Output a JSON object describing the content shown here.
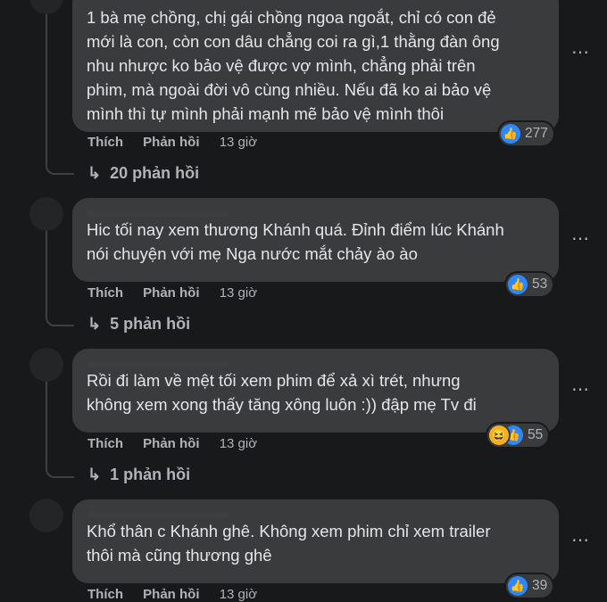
{
  "comments": [
    {
      "text": "1 bà mẹ chồng, chị gái chồng ngoa ngoắt, chỉ có con đẻ\nmới là con, còn con dâu chẳng coi ra gì,1 thằng đàn ông\nnhu nhược ko bảo vệ được vợ mình, chẳng phải trên\nphim, mà ngoài đời vô cùng nhiều. Nếu đã ko ai bảo vệ\nmình thì tự mình phải mạnh mẽ bảo vệ mình thôi",
      "like_label": "Thích",
      "reply_label": "Phản hồi",
      "time": "13 giờ",
      "reaction_count": "277",
      "replies_label": "20 phản hồi"
    },
    {
      "text": "Hic tối nay xem thương Khánh quá. Đỉnh điểm lúc Khánh\nnói chuyện với mẹ Nga nước mắt chảy ào ào",
      "like_label": "Thích",
      "reply_label": "Phản hồi",
      "time": "13 giờ",
      "reaction_count": "53",
      "replies_label": "5 phản hồi"
    },
    {
      "text": "Rồi đi làm về mệt tối xem phim để xả xì trét, nhưng\nkhông xem xong thấy tăng xông luôn :)) đập mẹ Tv đi",
      "like_label": "Thích",
      "reply_label": "Phản hồi",
      "time": "13 giờ",
      "reaction_count": "55",
      "replies_label": "1 phản hồi"
    },
    {
      "text": "Khổ thân c Khánh ghê. Không xem phim chỉ xem trailer\nthôi mà cũng thương ghê",
      "like_label": "Thích",
      "reply_label": "Phản hồi",
      "time": "13 giờ",
      "reaction_count": "39"
    }
  ],
  "icons": {
    "more": "⋯",
    "like": "👍",
    "haha": "😆",
    "reply_arrow": "↳"
  },
  "colors": {
    "background": "#18191a",
    "bubble": "#3a3b3c",
    "text": "#e4e6eb",
    "secondary_text": "#b0b3b8",
    "like_blue": "#2d88ff"
  }
}
